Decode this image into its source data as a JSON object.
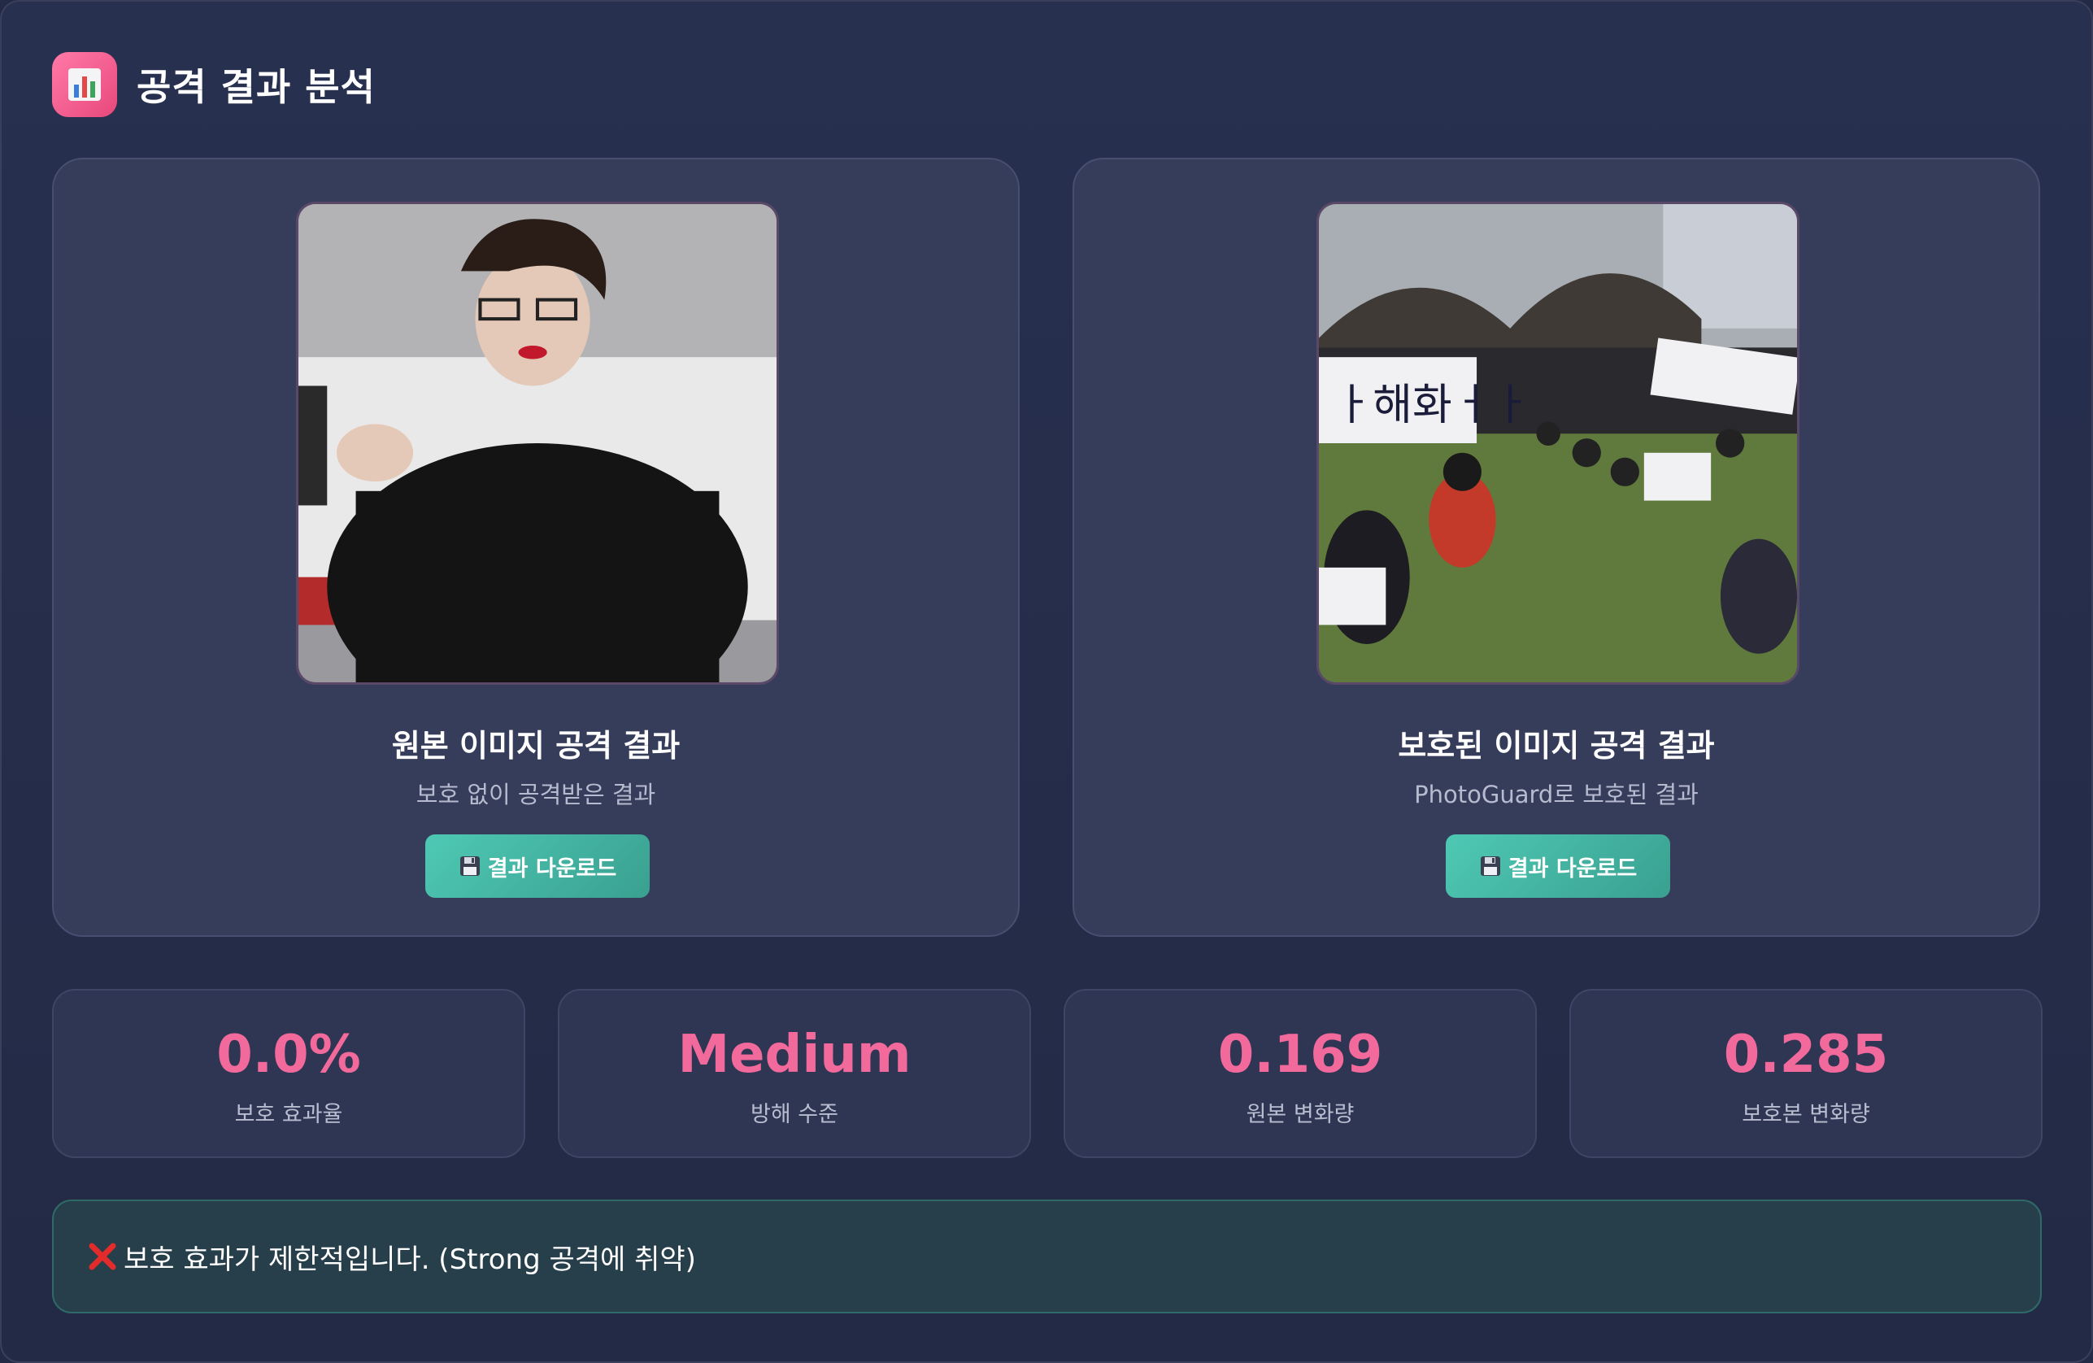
{
  "header": {
    "icon": "bar-chart-icon",
    "title": "공격 결과 분석"
  },
  "cards": [
    {
      "title": "원본 이미지 공격 결과",
      "subtitle": "보호 없이 공격받은 결과",
      "button_icon": "floppy-disk-icon",
      "button_label": "결과 다운로드"
    },
    {
      "title": "보호된 이미지 공격 결과",
      "subtitle": "PhotoGuard로 보호된 결과",
      "button_icon": "floppy-disk-icon",
      "button_label": "결과 다운로드"
    }
  ],
  "stats": [
    {
      "value": "0.0%",
      "label": "보호 효과율"
    },
    {
      "value": "Medium",
      "label": "방해 수준"
    },
    {
      "value": "0.169",
      "label": "원본 변화량"
    },
    {
      "value": "0.285",
      "label": "보호본 변화량"
    }
  ],
  "alert": {
    "icon": "red-x-icon",
    "text": "보호 효과가 제한적입니다. (Strong 공격에 취약)"
  },
  "colors": {
    "accent_pink": "#f26a9b",
    "button_teal": "#4ec9b4",
    "background": "#222a45",
    "card": "#363d5a"
  }
}
